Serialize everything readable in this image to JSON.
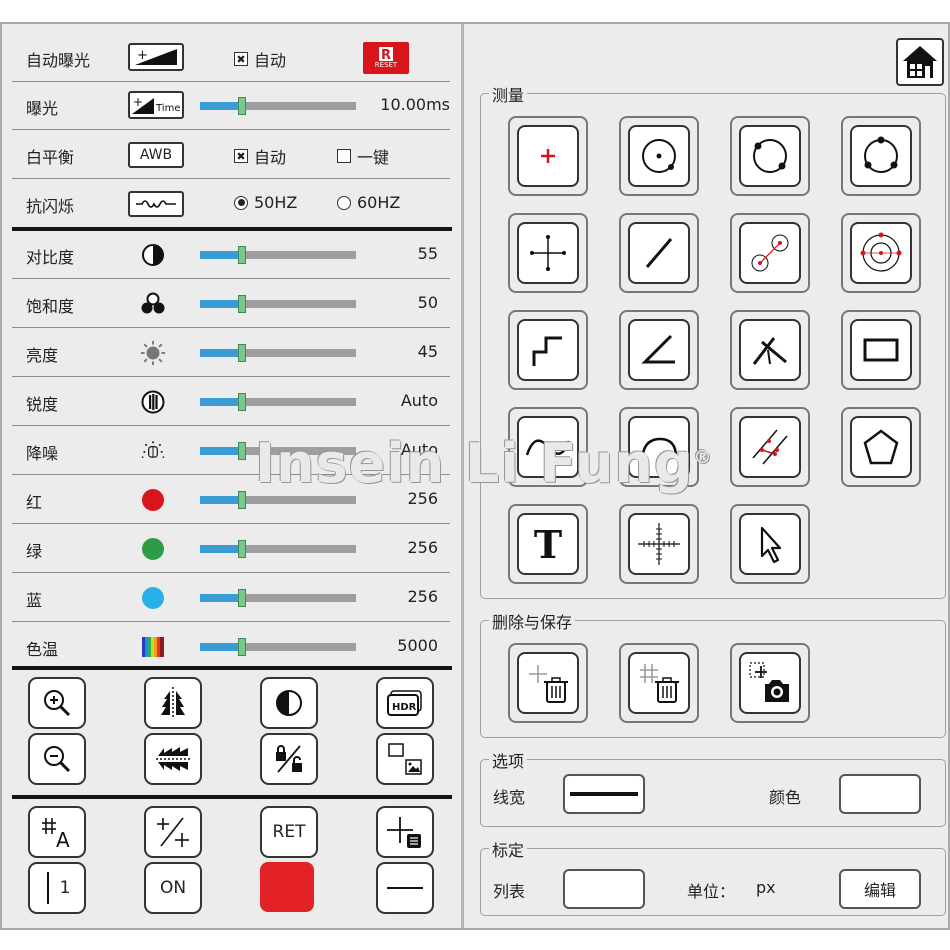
{
  "left": {
    "exposure_auto": {
      "label": "自动曝光",
      "checkbox_label": "自动",
      "checked": true,
      "reset_text": "RESET",
      "reset_color": "#d7151b"
    },
    "exposure": {
      "label": "曝光",
      "icon_text": "Time",
      "value": "10.00ms",
      "level": 0.27
    },
    "white_balance": {
      "label": "白平衡",
      "button_label": "AWB",
      "auto_label": "自动",
      "auto_checked": true,
      "onekey_label": "一键",
      "onekey_checked": false
    },
    "anti_flicker": {
      "label": "抗闪烁",
      "option_50": "50HZ",
      "option_60": "60HZ",
      "selected": "50HZ"
    },
    "adjustments": [
      {
        "label": "对比度",
        "icon": "contrast-icon",
        "value": "55",
        "level": 0.27
      },
      {
        "label": "饱和度",
        "icon": "saturation-icon",
        "value": "50",
        "level": 0.27
      },
      {
        "label": "亮度",
        "icon": "brightness-icon",
        "value": "45",
        "level": 0.27
      },
      {
        "label": "锐度",
        "icon": "sharpness-icon",
        "value": "Auto",
        "level": 0.27
      },
      {
        "label": "降噪",
        "icon": "denoise-icon",
        "value": "Auto",
        "level": 0.27
      },
      {
        "label": "红",
        "icon": "red-dot-icon",
        "value": "256",
        "level": 0.27,
        "color": "#d7151b"
      },
      {
        "label": "绿",
        "icon": "green-dot-icon",
        "value": "256",
        "level": 0.27,
        "color": "#2f9c45"
      },
      {
        "label": "蓝",
        "icon": "blue-dot-icon",
        "value": "256",
        "level": 0.27,
        "color": "#29b0e8"
      },
      {
        "label": "色温",
        "icon": "color-temp-icon",
        "value": "5000",
        "level": 0.27
      }
    ],
    "tools_bottom": {
      "ret_label": "RET",
      "on_label": "ON",
      "one_label": "1",
      "hdr_label": "HDR",
      "red_color": "#e32228"
    }
  },
  "right": {
    "measure_title": "测量",
    "delete_save_title": "删除与保存",
    "options": {
      "title": "选项",
      "line_width_label": "线宽",
      "color_label": "颜色"
    },
    "calibration": {
      "title": "标定",
      "list_label": "列表",
      "unit_label": "单位：",
      "unit_value": "px",
      "edit_button": "编辑"
    }
  },
  "watermark": {
    "text": "Insein Li Fung",
    "mark": "®"
  }
}
